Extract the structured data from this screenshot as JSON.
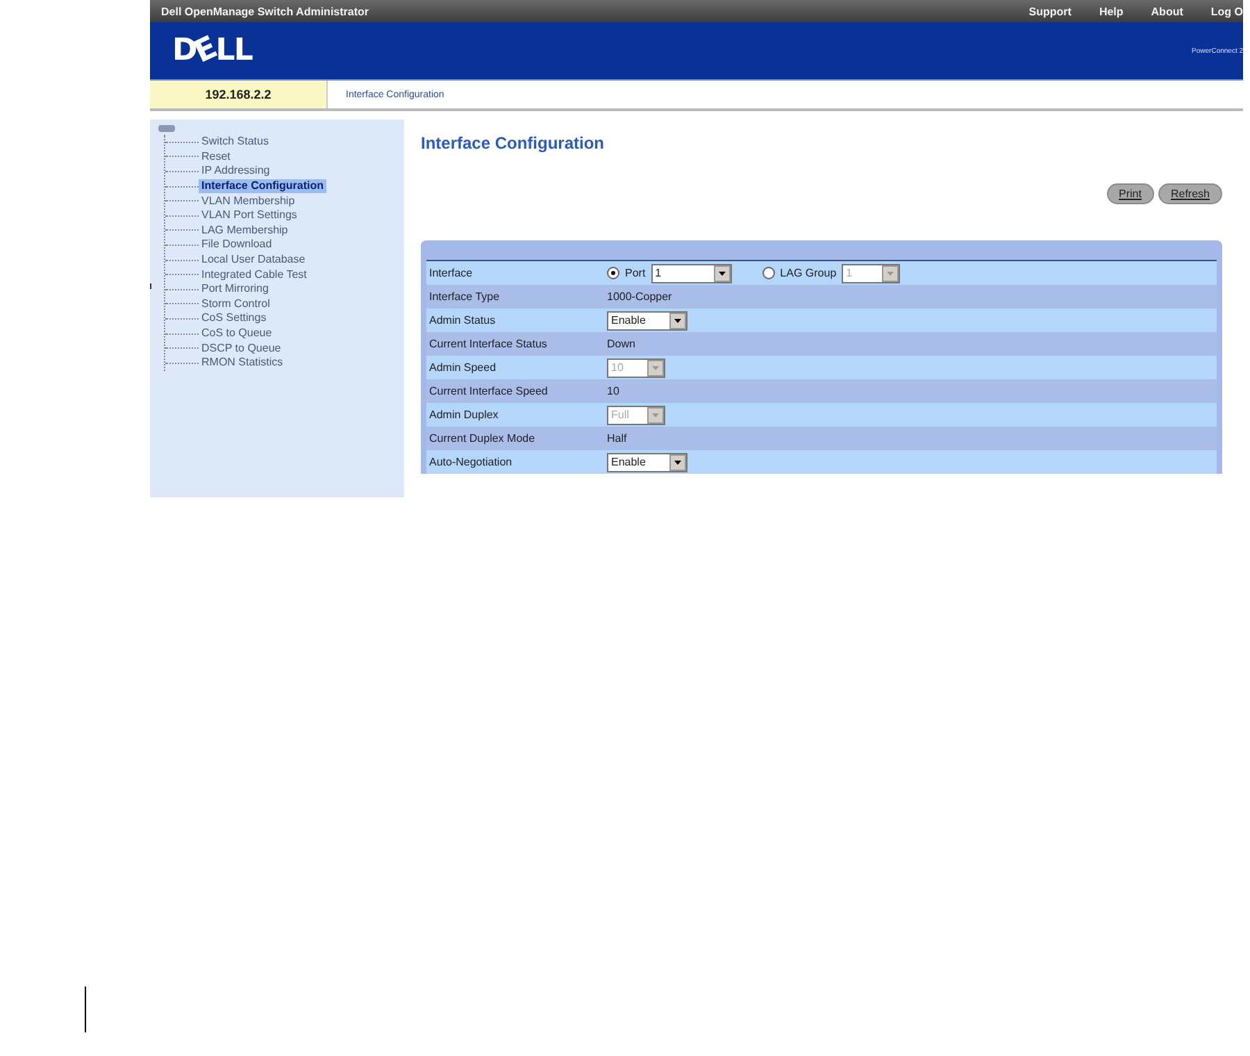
{
  "top_bar": {
    "title": "Dell OpenManage Switch Administrator",
    "links": [
      "Support",
      "Help",
      "About",
      "Log O"
    ]
  },
  "banner": {
    "logo": "DELL",
    "product": "PowerConnect 2"
  },
  "address_bar": {
    "address": "192.168.2.2",
    "breadcrumb": "Interface Configuration"
  },
  "sidebar": {
    "items": [
      {
        "label": "Switch Status",
        "selected": false
      },
      {
        "label": "Reset",
        "selected": false
      },
      {
        "label": "IP Addressing",
        "selected": false
      },
      {
        "label": "Interface Configuration",
        "selected": true
      },
      {
        "label": "VLAN Membership",
        "selected": false
      },
      {
        "label": "VLAN Port Settings",
        "selected": false
      },
      {
        "label": "LAG Membership",
        "selected": false
      },
      {
        "label": "File Download",
        "selected": false
      },
      {
        "label": "Local User Database",
        "selected": false
      },
      {
        "label": "Integrated Cable Test",
        "selected": false
      },
      {
        "label": "Port Mirroring",
        "selected": false
      },
      {
        "label": "Storm Control",
        "selected": false
      },
      {
        "label": "CoS Settings",
        "selected": false
      },
      {
        "label": "CoS to Queue",
        "selected": false
      },
      {
        "label": "DSCP to Queue",
        "selected": false
      },
      {
        "label": "RMON Statistics",
        "selected": false
      }
    ]
  },
  "page": {
    "title": "Interface Configuration",
    "buttons": [
      "Print",
      "Refresh"
    ],
    "rows": [
      {
        "label": "Interface",
        "kind": "radio",
        "options": [
          {
            "label": "Port",
            "selected": true,
            "value": "1"
          },
          {
            "label": "LAG Group",
            "selected": false,
            "value": "1"
          }
        ]
      },
      {
        "label": "Interface Type",
        "kind": "text",
        "value": "1000-Copper"
      },
      {
        "label": "Admin Status",
        "kind": "select",
        "value": "Enable",
        "disabled": false
      },
      {
        "label": "Current Interface Status",
        "kind": "text",
        "value": "Down"
      },
      {
        "label": "Admin Speed",
        "kind": "select",
        "value": "10",
        "disabled": true
      },
      {
        "label": "Current Interface Speed",
        "kind": "text",
        "value": "10"
      },
      {
        "label": "Admin Duplex",
        "kind": "select",
        "value": "Full",
        "disabled": true
      },
      {
        "label": "Current Duplex Mode",
        "kind": "text",
        "value": "Half"
      },
      {
        "label": "Auto-Negotiation",
        "kind": "select",
        "value": "Enable",
        "disabled": false
      }
    ]
  }
}
